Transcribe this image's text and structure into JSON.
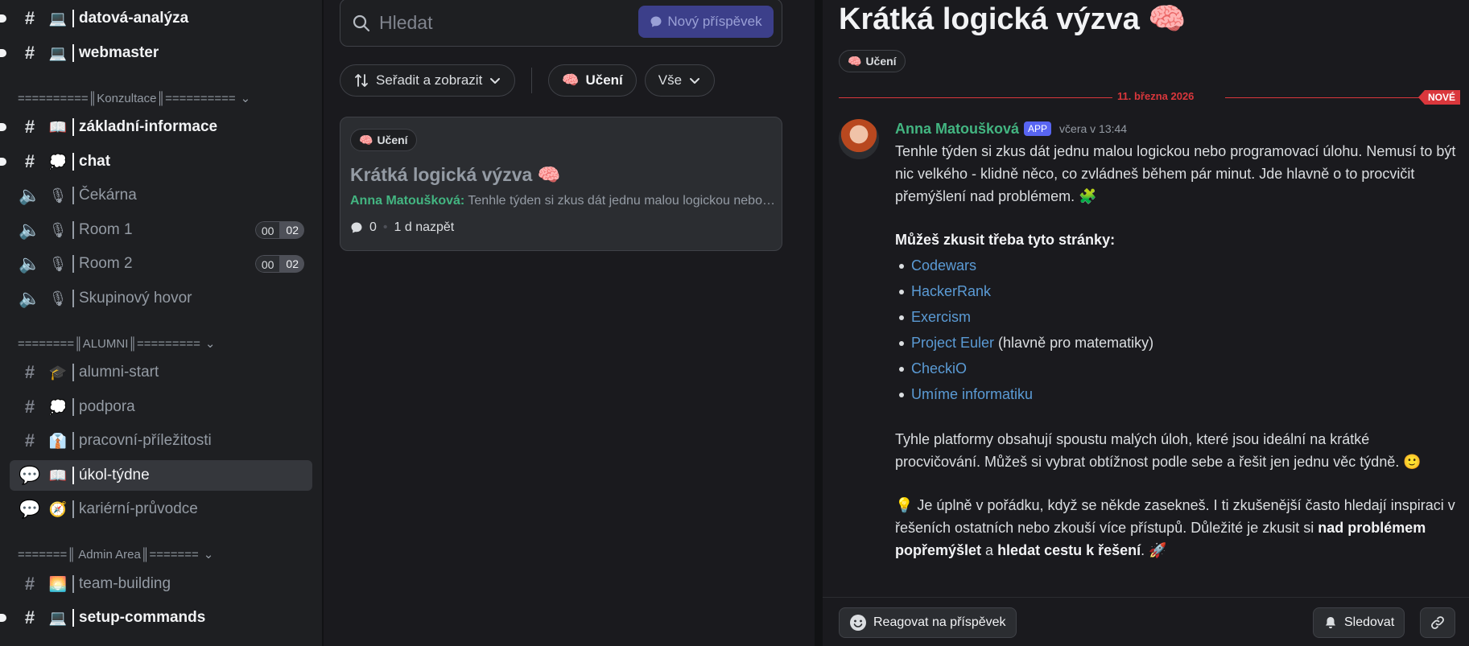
{
  "sidebar": {
    "channels_top": [
      {
        "emoji": "💻",
        "name": "datová-analýza"
      },
      {
        "emoji": "💻",
        "name": "webmaster"
      }
    ],
    "cat_konzultace": "==========║Konzultace║==========",
    "channels_konzultace": [
      {
        "emoji": "📖",
        "name": "základní-informace"
      },
      {
        "emoji": "💭",
        "name": "chat"
      }
    ],
    "voice": [
      {
        "emoji": "🎙",
        "name": "Čekárna"
      },
      {
        "emoji": "🎙",
        "name": "Room 1",
        "count_a": "00",
        "count_b": "02"
      },
      {
        "emoji": "🎙",
        "name": "Room 2",
        "count_a": "00",
        "count_b": "02"
      },
      {
        "emoji": "🎙",
        "name": "Skupinový hovor"
      }
    ],
    "cat_alumni": "========║ALUMNI║=========",
    "channels_alumni": [
      {
        "emoji": "🎓",
        "name": "alumni-start"
      },
      {
        "emoji": "💭",
        "name": "podpora"
      },
      {
        "emoji": "👔",
        "name": "pracovní-příležitosti"
      },
      {
        "emoji": "📖",
        "name": "úkol-týdne"
      },
      {
        "emoji": "🧭",
        "name": "kariérní-průvodce"
      }
    ],
    "cat_admin": "=======║ Admin Area║=======",
    "channels_admin": [
      {
        "emoji": "🌅",
        "name": "team-building"
      },
      {
        "emoji": "💻",
        "name": "setup-commands"
      }
    ]
  },
  "forum": {
    "search_placeholder": "Hledat",
    "new_post_label": "Nový příspěvek",
    "sort_label": "Seřadit a zobrazit",
    "tag_filter_emoji": "🧠",
    "tag_filter_label": "Učení",
    "all_label": "Vše",
    "post": {
      "tag_emoji": "🧠",
      "tag": "Učení",
      "title": "Krátká logická výzva 🧠",
      "author": "Anna Matoušková:",
      "preview": "Tenhle týden si zkus dát jednu malou logickou nebo programovací úlohu...",
      "comments": "0",
      "age": "1 d nazpět"
    }
  },
  "thread": {
    "title": "Krátká logická výzva 🧠",
    "tag_emoji": "🧠",
    "tag": "Učení",
    "date_divider": "11. března 2026",
    "new_badge": "NOVÉ",
    "author": "Anna Matoušková",
    "app_badge": "APP",
    "time": "včera v 13:44",
    "para1": "Tenhle týden si zkus dát jednu malou logickou nebo programovací úlohu. Nemusí to být nic velkého - klidně něco, co zvládneš během pár minut. Jde hlavně o to procvičit přemýšlení nad problémem. 🧩",
    "sites_heading": "Můžeš zkusit třeba tyto stránky:",
    "links": [
      {
        "label": "Codewars",
        "note": ""
      },
      {
        "label": "HackerRank",
        "note": ""
      },
      {
        "label": "Exercism",
        "note": ""
      },
      {
        "label": "Project Euler",
        "note": " (hlavně pro matematiky)"
      },
      {
        "label": "CheckiO",
        "note": ""
      },
      {
        "label": "Umíme informatiku",
        "note": ""
      }
    ],
    "para2": "Tyhle platformy obsahují spoustu malých úloh, které jsou ideální na krátké procvičování. Můžeš si vybrat obtížnost podle sebe a řešit jen jednu věc týdně. 🙂",
    "para3_start": "💡 Je úplně v pořádku, když se někde zasekneš. I ti zkušenější často hledají inspiraci v řešeních ostatních nebo zkouší více přístupů. Důležité je zkusit si ",
    "para3_bold1": "nad problémem popřemýšlet",
    "para3_mid": " a ",
    "para3_bold2": "hledat cestu k řešení",
    "para3_end": ". 🚀",
    "react_label": "Reagovat na příspěvek",
    "follow_label": "Sledovat"
  }
}
